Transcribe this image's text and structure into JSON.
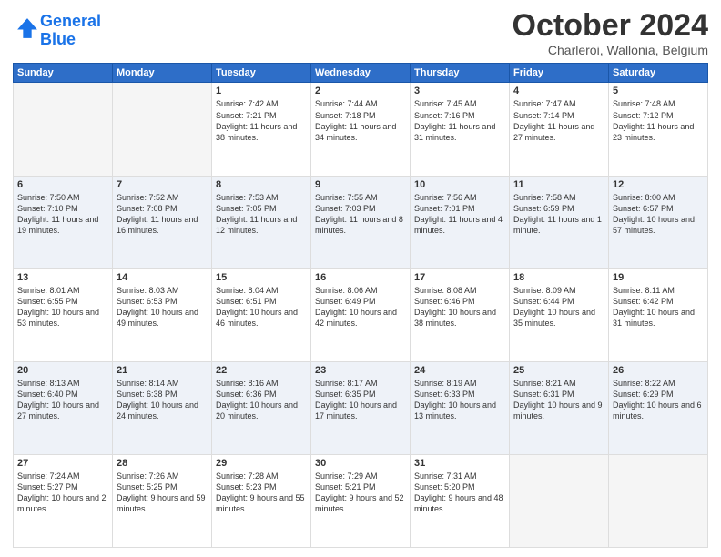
{
  "header": {
    "logo_line1": "General",
    "logo_line2": "Blue",
    "title": "October 2024",
    "subtitle": "Charleroi, Wallonia, Belgium"
  },
  "days_of_week": [
    "Sunday",
    "Monday",
    "Tuesday",
    "Wednesday",
    "Thursday",
    "Friday",
    "Saturday"
  ],
  "weeks": [
    [
      {
        "day": "",
        "empty": true
      },
      {
        "day": "",
        "empty": true
      },
      {
        "day": "1",
        "sunrise": "Sunrise: 7:42 AM",
        "sunset": "Sunset: 7:21 PM",
        "daylight": "Daylight: 11 hours and 38 minutes."
      },
      {
        "day": "2",
        "sunrise": "Sunrise: 7:44 AM",
        "sunset": "Sunset: 7:18 PM",
        "daylight": "Daylight: 11 hours and 34 minutes."
      },
      {
        "day": "3",
        "sunrise": "Sunrise: 7:45 AM",
        "sunset": "Sunset: 7:16 PM",
        "daylight": "Daylight: 11 hours and 31 minutes."
      },
      {
        "day": "4",
        "sunrise": "Sunrise: 7:47 AM",
        "sunset": "Sunset: 7:14 PM",
        "daylight": "Daylight: 11 hours and 27 minutes."
      },
      {
        "day": "5",
        "sunrise": "Sunrise: 7:48 AM",
        "sunset": "Sunset: 7:12 PM",
        "daylight": "Daylight: 11 hours and 23 minutes."
      }
    ],
    [
      {
        "day": "6",
        "sunrise": "Sunrise: 7:50 AM",
        "sunset": "Sunset: 7:10 PM",
        "daylight": "Daylight: 11 hours and 19 minutes."
      },
      {
        "day": "7",
        "sunrise": "Sunrise: 7:52 AM",
        "sunset": "Sunset: 7:08 PM",
        "daylight": "Daylight: 11 hours and 16 minutes."
      },
      {
        "day": "8",
        "sunrise": "Sunrise: 7:53 AM",
        "sunset": "Sunset: 7:05 PM",
        "daylight": "Daylight: 11 hours and 12 minutes."
      },
      {
        "day": "9",
        "sunrise": "Sunrise: 7:55 AM",
        "sunset": "Sunset: 7:03 PM",
        "daylight": "Daylight: 11 hours and 8 minutes."
      },
      {
        "day": "10",
        "sunrise": "Sunrise: 7:56 AM",
        "sunset": "Sunset: 7:01 PM",
        "daylight": "Daylight: 11 hours and 4 minutes."
      },
      {
        "day": "11",
        "sunrise": "Sunrise: 7:58 AM",
        "sunset": "Sunset: 6:59 PM",
        "daylight": "Daylight: 11 hours and 1 minute."
      },
      {
        "day": "12",
        "sunrise": "Sunrise: 8:00 AM",
        "sunset": "Sunset: 6:57 PM",
        "daylight": "Daylight: 10 hours and 57 minutes."
      }
    ],
    [
      {
        "day": "13",
        "sunrise": "Sunrise: 8:01 AM",
        "sunset": "Sunset: 6:55 PM",
        "daylight": "Daylight: 10 hours and 53 minutes."
      },
      {
        "day": "14",
        "sunrise": "Sunrise: 8:03 AM",
        "sunset": "Sunset: 6:53 PM",
        "daylight": "Daylight: 10 hours and 49 minutes."
      },
      {
        "day": "15",
        "sunrise": "Sunrise: 8:04 AM",
        "sunset": "Sunset: 6:51 PM",
        "daylight": "Daylight: 10 hours and 46 minutes."
      },
      {
        "day": "16",
        "sunrise": "Sunrise: 8:06 AM",
        "sunset": "Sunset: 6:49 PM",
        "daylight": "Daylight: 10 hours and 42 minutes."
      },
      {
        "day": "17",
        "sunrise": "Sunrise: 8:08 AM",
        "sunset": "Sunset: 6:46 PM",
        "daylight": "Daylight: 10 hours and 38 minutes."
      },
      {
        "day": "18",
        "sunrise": "Sunrise: 8:09 AM",
        "sunset": "Sunset: 6:44 PM",
        "daylight": "Daylight: 10 hours and 35 minutes."
      },
      {
        "day": "19",
        "sunrise": "Sunrise: 8:11 AM",
        "sunset": "Sunset: 6:42 PM",
        "daylight": "Daylight: 10 hours and 31 minutes."
      }
    ],
    [
      {
        "day": "20",
        "sunrise": "Sunrise: 8:13 AM",
        "sunset": "Sunset: 6:40 PM",
        "daylight": "Daylight: 10 hours and 27 minutes."
      },
      {
        "day": "21",
        "sunrise": "Sunrise: 8:14 AM",
        "sunset": "Sunset: 6:38 PM",
        "daylight": "Daylight: 10 hours and 24 minutes."
      },
      {
        "day": "22",
        "sunrise": "Sunrise: 8:16 AM",
        "sunset": "Sunset: 6:36 PM",
        "daylight": "Daylight: 10 hours and 20 minutes."
      },
      {
        "day": "23",
        "sunrise": "Sunrise: 8:17 AM",
        "sunset": "Sunset: 6:35 PM",
        "daylight": "Daylight: 10 hours and 17 minutes."
      },
      {
        "day": "24",
        "sunrise": "Sunrise: 8:19 AM",
        "sunset": "Sunset: 6:33 PM",
        "daylight": "Daylight: 10 hours and 13 minutes."
      },
      {
        "day": "25",
        "sunrise": "Sunrise: 8:21 AM",
        "sunset": "Sunset: 6:31 PM",
        "daylight": "Daylight: 10 hours and 9 minutes."
      },
      {
        "day": "26",
        "sunrise": "Sunrise: 8:22 AM",
        "sunset": "Sunset: 6:29 PM",
        "daylight": "Daylight: 10 hours and 6 minutes."
      }
    ],
    [
      {
        "day": "27",
        "sunrise": "Sunrise: 7:24 AM",
        "sunset": "Sunset: 5:27 PM",
        "daylight": "Daylight: 10 hours and 2 minutes."
      },
      {
        "day": "28",
        "sunrise": "Sunrise: 7:26 AM",
        "sunset": "Sunset: 5:25 PM",
        "daylight": "Daylight: 9 hours and 59 minutes."
      },
      {
        "day": "29",
        "sunrise": "Sunrise: 7:28 AM",
        "sunset": "Sunset: 5:23 PM",
        "daylight": "Daylight: 9 hours and 55 minutes."
      },
      {
        "day": "30",
        "sunrise": "Sunrise: 7:29 AM",
        "sunset": "Sunset: 5:21 PM",
        "daylight": "Daylight: 9 hours and 52 minutes."
      },
      {
        "day": "31",
        "sunrise": "Sunrise: 7:31 AM",
        "sunset": "Sunset: 5:20 PM",
        "daylight": "Daylight: 9 hours and 48 minutes."
      },
      {
        "day": "",
        "empty": true
      },
      {
        "day": "",
        "empty": true
      }
    ]
  ]
}
